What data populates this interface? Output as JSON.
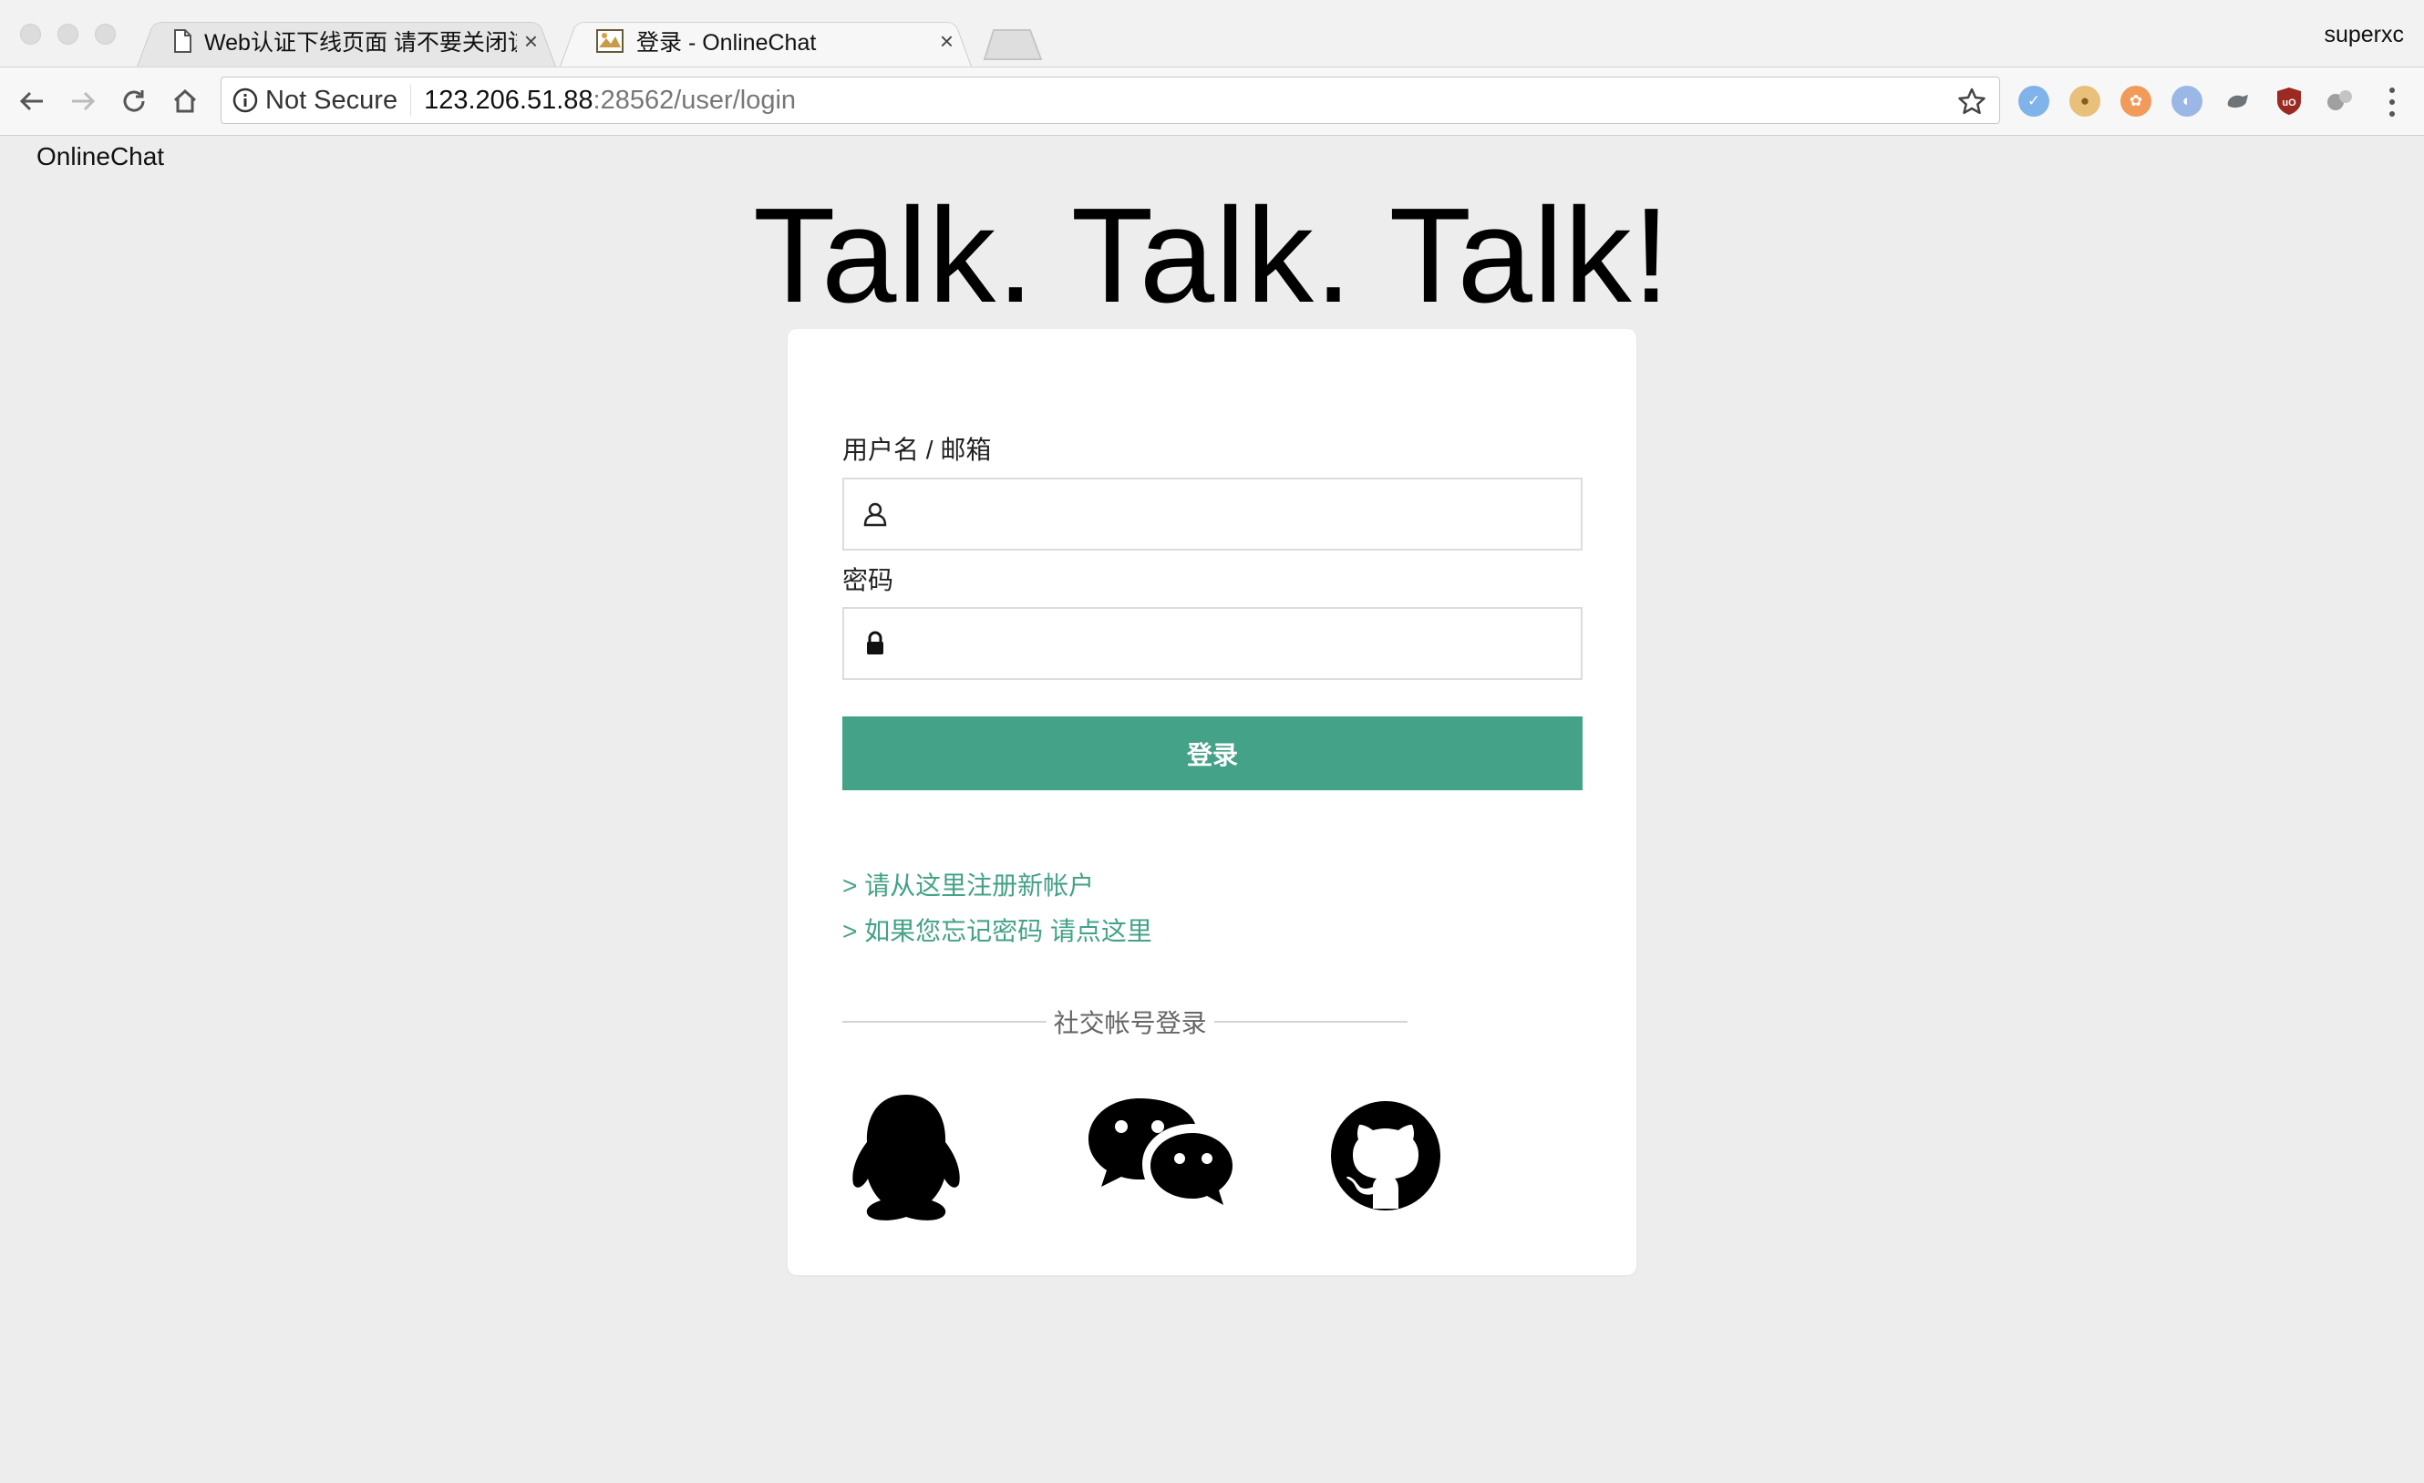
{
  "browser": {
    "tabs": [
      {
        "title": "Web认证下线页面 请不要关闭该",
        "active": false
      },
      {
        "title": "登录 - OnlineChat",
        "active": true
      }
    ],
    "profile_name": "superxc",
    "security_label": "Not Secure",
    "url_host": "123.206.51.88",
    "url_rest": ":28562/user/login",
    "close_glyph": "×"
  },
  "page": {
    "brand": "OnlineChat",
    "headline": "Talk. Talk. Talk!",
    "form": {
      "username_label": "用户名 / 邮箱",
      "username_value": "",
      "password_label": "密码",
      "password_value": "",
      "login_button": "登录"
    },
    "links": {
      "register": "> 请从这里注册新帐户",
      "forgot": "> 如果您忘记密码 请点这里"
    },
    "social": {
      "title": "社交帐号登录",
      "providers": [
        "qq-icon",
        "wechat-icon",
        "github-icon"
      ]
    },
    "colors": {
      "accent": "#43a287",
      "background": "#ededed",
      "card": "#ffffff"
    }
  }
}
